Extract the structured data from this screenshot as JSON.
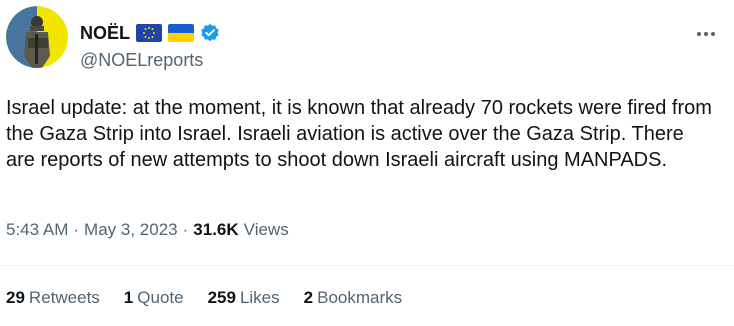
{
  "author": {
    "name": "NOËL",
    "handle": "@NOELreports",
    "verified": true,
    "flags": [
      "eu-flag-icon",
      "ukraine-flag-icon"
    ]
  },
  "tweet": {
    "text": "Israel update: at the moment, it is known that already 70 rockets were fired from the Gaza Strip into Israel. Israeli aviation is active over the Gaza Strip. There are reports of new attempts to shoot down Israeli aircraft using MANPADS."
  },
  "meta": {
    "time": "5:43 AM",
    "separator": "·",
    "date": "May 3, 2023",
    "views_count": "31.6K",
    "views_label": "Views"
  },
  "stats": [
    {
      "count": "29",
      "label": "Retweets"
    },
    {
      "count": "1",
      "label": "Quote"
    },
    {
      "count": "259",
      "label": "Likes"
    },
    {
      "count": "2",
      "label": "Bookmarks"
    }
  ],
  "colors": {
    "text": "#0f1419",
    "secondary": "#536471",
    "verified": "#1d9bf0",
    "divider": "#eff3f4",
    "avatar_bg": "#f2e600"
  }
}
